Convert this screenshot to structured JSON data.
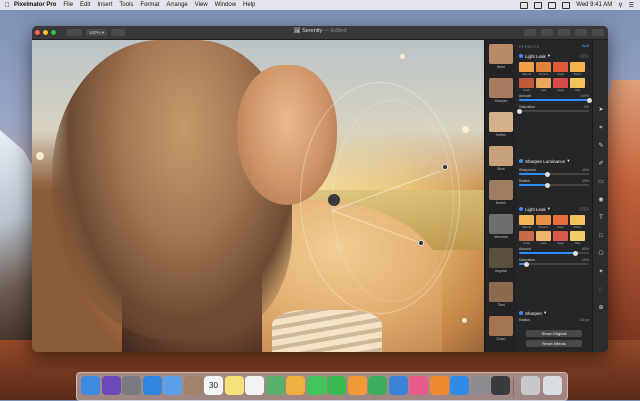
{
  "menubar": {
    "app": "Pixelmator Pro",
    "items": [
      "File",
      "Edit",
      "Insert",
      "Tools",
      "Format",
      "Arrange",
      "View",
      "Window",
      "Help"
    ],
    "clock": "Wed 9:41 AM"
  },
  "window": {
    "title": "Serenity",
    "title_state": "— Edited",
    "zoom": "100% ▾"
  },
  "presets": [
    {
      "label": "None",
      "color": "#b98a66"
    },
    {
      "label": "Sharpen",
      "color": "#a77b5e"
    },
    {
      "label": "Soften",
      "color": "#d6b08a"
    },
    {
      "label": "Blow",
      "color": "#c8a27d"
    },
    {
      "label": "Bokeh",
      "color": "#9f7d60"
    },
    {
      "label": "Mandala",
      "color": "#6e6e6e"
    },
    {
      "label": "Angular",
      "color": "#5a5040"
    },
    {
      "label": "Tiled",
      "color": "#8c6a50"
    },
    {
      "label": "Zoom",
      "color": "#a47454"
    }
  ],
  "effects": {
    "header": "EFFECTS",
    "add_label": "Add",
    "light_leak_1": {
      "title": "Light Leak",
      "swatches": [
        {
          "t": "Natural",
          "c": "#f1a04a"
        },
        {
          "t": "Autumn",
          "c": "#e0843c"
        },
        {
          "t": "Vega",
          "c": "#e35a3a"
        },
        {
          "t": "Flame",
          "c": "#f4b248"
        },
        {
          "t": "Dusk",
          "c": "#c25a3a"
        },
        {
          "t": "Lark",
          "c": "#e9a860"
        },
        {
          "t": "Vega",
          "c": "#d64a48"
        },
        {
          "t": "Tally",
          "c": "#f2c45a"
        }
      ],
      "amount_label": "Amount",
      "amount_value": "100%",
      "amount": 1.0,
      "saturation_label": "Saturation",
      "saturation_value": "0%",
      "saturation": 0.0
    },
    "sharpen_luminance": {
      "title": "Sharpen Luminance",
      "sharpness_label": "Sharpness",
      "sharpness_value": "40%",
      "sharpness": 0.4,
      "radius_label": "Radius",
      "radius_value": "40%",
      "radius": 0.4
    },
    "light_leak_2": {
      "title": "Light Leak",
      "swatches": [
        {
          "t": "Natural",
          "c": "#f3b45a"
        },
        {
          "t": "Autumn",
          "c": "#e99048"
        },
        {
          "t": "Vega",
          "c": "#e56d3e"
        },
        {
          "t": "Flame",
          "c": "#f6c25c"
        },
        {
          "t": "Dusk",
          "c": "#c86a48"
        },
        {
          "t": "Lark",
          "c": "#eeb56a"
        },
        {
          "t": "Vega",
          "c": "#d65a4c"
        },
        {
          "t": "Tally",
          "c": "#f3cd66"
        }
      ],
      "amount_label": "Amount",
      "amount_value": "80%",
      "amount": 0.8,
      "saturation_label": "Saturation",
      "saturation_value": "10%",
      "saturation": 0.1
    },
    "sharpen": {
      "title": "Sharpen",
      "radius_label": "Radius",
      "radius_value": "2.5 px"
    },
    "show_original": "Show Original",
    "reset_effects": "Reset Effects"
  },
  "tools": [
    "pointer-icon",
    "crop-icon",
    "paint-icon",
    "brush-icon",
    "eraser-icon",
    "fill-icon",
    "text-icon",
    "shape-icon",
    "stamp-icon",
    "magic-icon",
    "lasso-icon",
    "zoom-icon"
  ],
  "dock": {
    "calendar_day": "30",
    "icons": [
      {
        "name": "finder-icon",
        "c": "#3d8be0"
      },
      {
        "name": "siri-icon",
        "c": "#6a4ab8"
      },
      {
        "name": "launchpad-icon",
        "c": "#7a7a82"
      },
      {
        "name": "safari-icon",
        "c": "#2f85e0"
      },
      {
        "name": "mail-icon",
        "c": "#5aa0e8"
      },
      {
        "name": "contacts-icon",
        "c": "#a0826a"
      },
      {
        "name": "calendar-icon",
        "c": "#f5f5f5"
      },
      {
        "name": "notes-icon",
        "c": "#f6e27a"
      },
      {
        "name": "reminders-icon",
        "c": "#f2f2f2"
      },
      {
        "name": "maps-icon",
        "c": "#5ab06a"
      },
      {
        "name": "photos-icon",
        "c": "#f0b040"
      },
      {
        "name": "messages-icon",
        "c": "#43c45a"
      },
      {
        "name": "facetime-icon",
        "c": "#3cb850"
      },
      {
        "name": "pages-icon",
        "c": "#f29a38"
      },
      {
        "name": "numbers-icon",
        "c": "#3fae5c"
      },
      {
        "name": "keynote-icon",
        "c": "#3b82d8"
      },
      {
        "name": "itunes-icon",
        "c": "#e85a8a"
      },
      {
        "name": "ibooks-icon",
        "c": "#f08a30"
      },
      {
        "name": "appstore-icon",
        "c": "#2f8ae8"
      },
      {
        "name": "settings-icon",
        "c": "#8a8a90"
      },
      {
        "name": "pixelmator-icon",
        "c": "#3a3a40"
      },
      {
        "name": "downloads-icon",
        "c": "#c8c8cc"
      },
      {
        "name": "trash-icon",
        "c": "#d8dde2"
      }
    ]
  }
}
